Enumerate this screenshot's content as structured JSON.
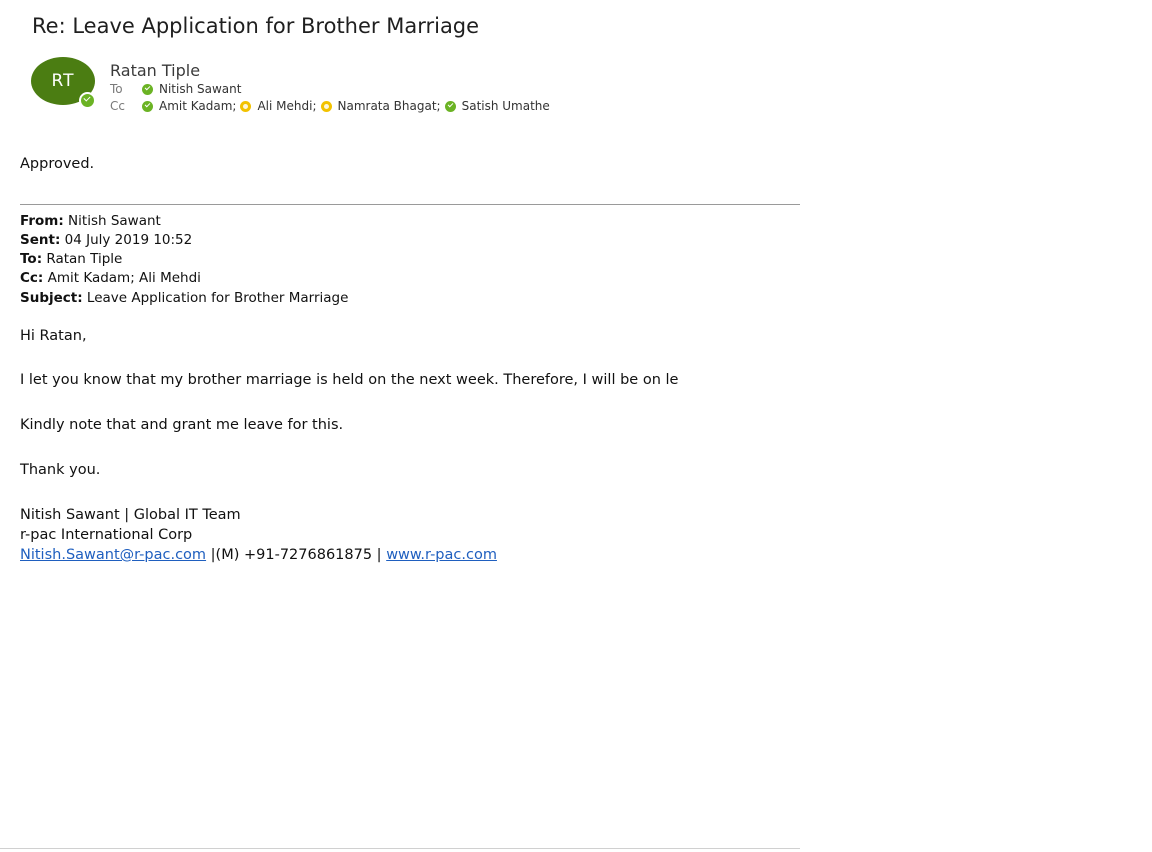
{
  "email": {
    "subject": "Re: Leave Application for Brother Marriage",
    "sender_initials": "RT",
    "sender_name": "Ratan Tiple",
    "to_label": "To",
    "cc_label": "Cc",
    "to": [
      {
        "name": "Nitish Sawant",
        "presence": "available"
      }
    ],
    "cc": [
      {
        "name": "Amit Kadam;",
        "presence": "available"
      },
      {
        "name": "Ali Mehdi;",
        "presence": "away"
      },
      {
        "name": "Namrata Bhagat;",
        "presence": "away"
      },
      {
        "name": "Satish Umathe",
        "presence": "available"
      }
    ],
    "reply_body": "Approved."
  },
  "quoted": {
    "from_label": "From:",
    "from_value": " Nitish Sawant",
    "sent_label": "Sent:",
    "sent_value": " 04 July 2019 10:52",
    "to_label": "To:",
    "to_value": " Ratan Tiple",
    "cc_label": "Cc:",
    "cc_value": " Amit Kadam; Ali Mehdi",
    "subject_label": "Subject:",
    "subject_value": " Leave Application for Brother Marriage",
    "greeting": "Hi Ratan,",
    "paragraph1": "I let you know that my brother marriage is held on the next week. Therefore, I will be on le",
    "paragraph2": "Kindly note that and grant me leave for this.",
    "closing": "Thank you.",
    "signature_line1": "Nitish Sawant | Global IT Team",
    "signature_line2": "r-pac International Corp",
    "signature_email": "Nitish.Sawant@r-pac.com",
    "signature_phone": " |(M) +91-7276861875 | ",
    "signature_website": "www.r-pac.com"
  },
  "colors": {
    "avatar_bg": "#4b7d12",
    "presence_available": "#6bb324",
    "presence_away": "#f2c200",
    "link": "#1f5fbf"
  },
  "icons": {
    "avatar_status": "checkmark-presence-icon",
    "available": "green-check-presence-icon",
    "away": "yellow-clock-presence-icon"
  }
}
